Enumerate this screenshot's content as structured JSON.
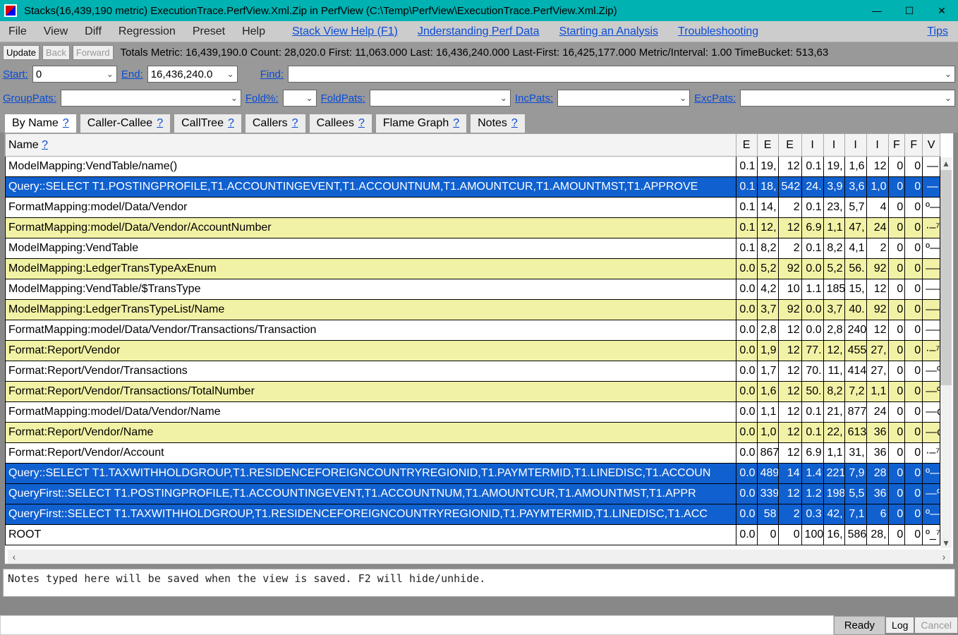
{
  "window": {
    "title": "Stacks(16,439,190 metric) ExecutionTrace.PerfView.Xml.Zip in PerfView (C:\\Temp\\PerfView\\ExecutionTrace.PerfView.Xml.Zip)"
  },
  "menu": {
    "file": "File",
    "view": "View",
    "diff": "Diff",
    "regression": "Regression",
    "preset": "Preset",
    "help": "Help",
    "links": {
      "stackviewhelp": "Stack View Help (F1)",
      "understanding": "Jnderstanding Perf Data",
      "starting": "Starting an Analysis",
      "troubleshooting": "Troubleshooting",
      "tips": "Tips"
    }
  },
  "toolbar": {
    "update": "Update",
    "back": "Back",
    "forward": "Forward",
    "totals": "Totals Metric: 16,439,190.0  Count: 28,020.0  First: 11,063.000 Last: 16,436,240.000  Last-First: 16,425,177.000  Metric/Interval: 1.00  TimeBucket: 513,63"
  },
  "filters": {
    "start_label": "Start:",
    "start_value": "0",
    "end_label": "End:",
    "end_value": "16,436,240.0",
    "find_label": "Find:",
    "find_value": "",
    "grouppats_label": "GroupPats:",
    "grouppats_value": "",
    "foldpct_label": "Fold%:",
    "foldpct_value": "",
    "foldpats_label": "FoldPats:",
    "foldpats_value": "",
    "incpats_label": "IncPats:",
    "incpats_value": "",
    "excpats_label": "ExcPats:",
    "excpats_value": ""
  },
  "tabs": {
    "byname": "By Name",
    "callercallee": "Caller-Callee",
    "calltree": "CallTree",
    "callers": "Callers",
    "callees": "Callees",
    "flamegraph": "Flame Graph",
    "notes": "Notes",
    "q": "?"
  },
  "columns": [
    "Name ",
    "E",
    "E",
    "E",
    "I",
    "I",
    "I",
    "I",
    "F",
    "F",
    "V"
  ],
  "rows": [
    {
      "name": "ModelMapping:VendTable/name()",
      "cells": [
        "0.1",
        "19,",
        "12",
        "0.1",
        "19,",
        "1,6",
        "12",
        "0",
        "0",
        "—"
      ],
      "style": ""
    },
    {
      "name": "Query::SELECT T1.POSTINGPROFILE,T1.ACCOUNTINGEVENT,T1.ACCOUNTNUM,T1.AMOUNTCUR,T1.AMOUNTMST,T1.APPROVE",
      "cells": [
        "0.1",
        "18,",
        "542",
        "24.",
        "3,9",
        "3,6",
        "1,0",
        "0",
        "0",
        "—"
      ],
      "style": "sel"
    },
    {
      "name": "FormatMapping:model/Data/Vendor",
      "cells": [
        "0.1",
        "14,",
        "2",
        "0.1",
        "23,",
        "5,7",
        "4",
        "0",
        "0",
        "º—"
      ],
      "style": ""
    },
    {
      "name": "FormatMapping:model/Data/Vendor/AccountNumber",
      "cells": [
        "0.1",
        "12,",
        "12",
        "6.9",
        "1,1",
        "47,",
        "24",
        "0",
        "0",
        "·–⁷"
      ],
      "style": "alt"
    },
    {
      "name": "ModelMapping:VendTable",
      "cells": [
        "0.1",
        "8,2",
        "2",
        "0.1",
        "8,2",
        "4,1",
        "2",
        "0",
        "0",
        "º—"
      ],
      "style": ""
    },
    {
      "name": "ModelMapping:LedgerTransTypeAxEnum",
      "cells": [
        "0.0",
        "5,2",
        "92",
        "0.0",
        "5,2",
        "56.",
        "92",
        "0",
        "0",
        "——"
      ],
      "style": "alt"
    },
    {
      "name": "ModelMapping:VendTable/$TransType",
      "cells": [
        "0.0",
        "4,2",
        "10",
        "1.1",
        "185",
        "15,",
        "12",
        "0",
        "0",
        "——"
      ],
      "style": ""
    },
    {
      "name": "ModelMapping:LedgerTransTypeList/Name",
      "cells": [
        "0.0",
        "3,7",
        "92",
        "0.0",
        "3,7",
        "40.",
        "92",
        "0",
        "0",
        "——"
      ],
      "style": "alt"
    },
    {
      "name": "FormatMapping:model/Data/Vendor/Transactions/Transaction",
      "cells": [
        "0.0",
        "2,8",
        "12",
        "0.0",
        "2,8",
        "240",
        "12",
        "0",
        "0",
        "——"
      ],
      "style": ""
    },
    {
      "name": "Format:Report/Vendor",
      "cells": [
        "0.0",
        "1,9",
        "12",
        "77.",
        "12,",
        "455",
        "27,",
        "0",
        "0",
        "·–⁷"
      ],
      "style": "alt"
    },
    {
      "name": "Format:Report/Vendor/Transactions",
      "cells": [
        "0.0",
        "1,7",
        "12",
        "70.",
        "11,",
        "414",
        "27,",
        "0",
        "0",
        "—º"
      ],
      "style": ""
    },
    {
      "name": "Format:Report/Vendor/Transactions/TotalNumber",
      "cells": [
        "0.0",
        "1,6",
        "12",
        "50.",
        "8,2",
        "7,2",
        "1,1",
        "0",
        "0",
        "—º"
      ],
      "style": "alt"
    },
    {
      "name": "FormatMapping:model/Data/Vendor/Name",
      "cells": [
        "0.0",
        "1,1",
        "12",
        "0.1",
        "21,",
        "877",
        "24",
        "0",
        "0",
        "—c"
      ],
      "style": ""
    },
    {
      "name": "Format:Report/Vendor/Name",
      "cells": [
        "0.0",
        "1,0",
        "12",
        "0.1",
        "22,",
        "613",
        "36",
        "0",
        "0",
        "—c"
      ],
      "style": "alt"
    },
    {
      "name": "Format:Report/Vendor/Account",
      "cells": [
        "0.0",
        "867",
        "12",
        "6.9",
        "1,1",
        "31,",
        "36",
        "0",
        "0",
        "·–⁷"
      ],
      "style": ""
    },
    {
      "name": "Query::SELECT T1.TAXWITHHOLDGROUP,T1.RESIDENCEFOREIGNCOUNTRYREGIONID,T1.PAYMTERMID,T1.LINEDISC,T1.ACCOUN",
      "cells": [
        "0.0",
        "489",
        "14",
        "1.4",
        "221",
        "7,9",
        "28",
        "0",
        "0",
        "º—"
      ],
      "style": "sel"
    },
    {
      "name": "QueryFirst::SELECT T1.POSTINGPROFILE,T1.ACCOUNTINGEVENT,T1.ACCOUNTNUM,T1.AMOUNTCUR,T1.AMOUNTMST,T1.APPR",
      "cells": [
        "0.0",
        "339",
        "12",
        "1.2",
        "198",
        "5,5",
        "36",
        "0",
        "0",
        "—º"
      ],
      "style": "sel"
    },
    {
      "name": "QueryFirst::SELECT T1.TAXWITHHOLDGROUP,T1.RESIDENCEFOREIGNCOUNTRYREGIONID,T1.PAYMTERMID,T1.LINEDISC,T1.ACC",
      "cells": [
        "0.0",
        "58",
        "2",
        "0.3",
        "42,",
        "7,1",
        "6",
        "0",
        "0",
        "º—"
      ],
      "style": "sel"
    },
    {
      "name": "ROOT",
      "cells": [
        "0.0",
        "0",
        "0",
        "100",
        "16,",
        "586",
        "28,",
        "0",
        "0",
        "º_⁷"
      ],
      "style": ""
    }
  ],
  "notes": {
    "placeholder": "Notes typed here will be saved when the view is saved. F2 will hide/unhide."
  },
  "status": {
    "ready": "Ready",
    "log": "Log",
    "cancel": "Cancel"
  }
}
